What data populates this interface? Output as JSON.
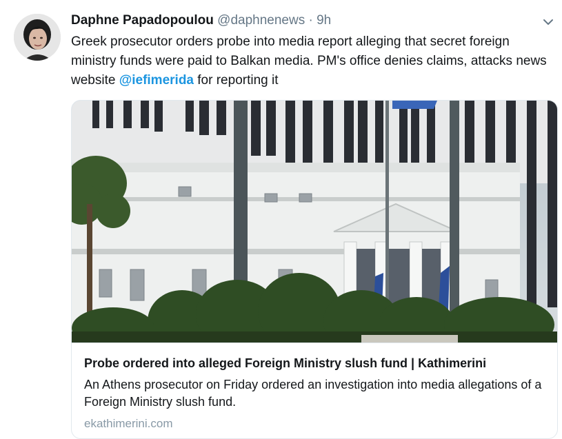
{
  "tweet": {
    "author_name": "Daphne Papadopoulou",
    "author_handle": "@daphnenews",
    "separator": "·",
    "time": "9h",
    "text_before": "Greek prosecutor orders probe into media report alleging that secret foreign ministry funds were paid to Balkan media. PM's office denies claims, attacks news website ",
    "mention": "@iefimerida",
    "text_after": " for reporting it"
  },
  "card": {
    "title": "Probe ordered into alleged Foreign Ministry slush fund | Kathimerini",
    "description": "An Athens prosecutor on Friday ordered an investigation into media allegations of a Foreign Ministry slush fund.",
    "domain": "ekathimerini.com"
  },
  "icons": {
    "menu": "chevron-down-icon"
  },
  "colors": {
    "link": "#1b95e0",
    "secondary_text": "#657786",
    "domain_text": "#8899a6",
    "border": "#e1e8ed"
  }
}
